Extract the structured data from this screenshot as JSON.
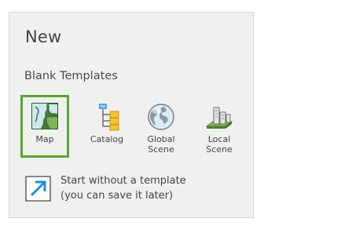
{
  "new_panel": {
    "title": "New",
    "section_label": "Blank Templates",
    "selected_border_color": "#59a82e",
    "templates": [
      {
        "label": "Map",
        "icon": "map-icon",
        "selected": true
      },
      {
        "label": "Catalog",
        "icon": "catalog-icon",
        "selected": false
      },
      {
        "label": "Global\nScene",
        "icon": "globe-icon",
        "selected": false
      },
      {
        "label": "Local\nScene",
        "icon": "local-scene-icon",
        "selected": false
      }
    ],
    "start_without_template": {
      "icon": "arrow-out-icon",
      "text": "Start without a template\n(you can save it later)"
    }
  }
}
